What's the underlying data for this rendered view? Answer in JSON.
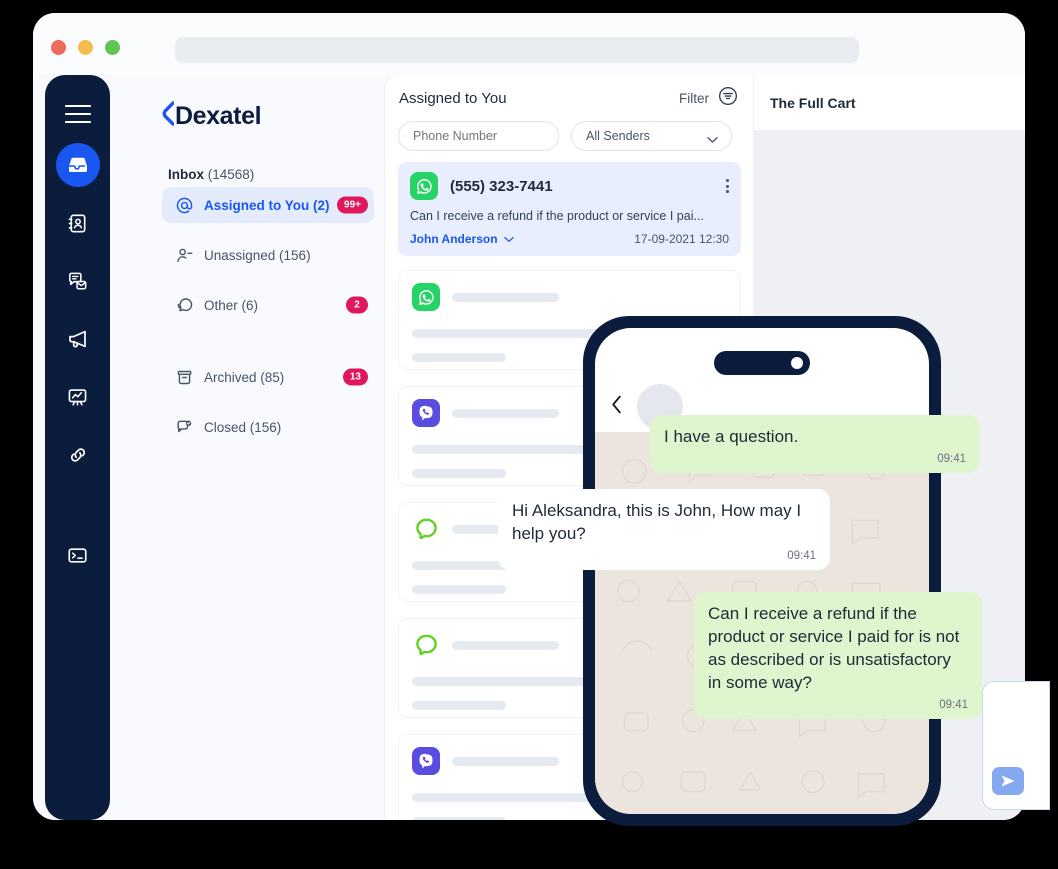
{
  "window": {
    "traffic_lights": [
      "close",
      "minimize",
      "maximize"
    ],
    "url_value": ""
  },
  "rail": {
    "menu_icon": "hamburger-menu-icon",
    "items": [
      {
        "icon": "inbox-icon",
        "name": "inbox",
        "active": true
      },
      {
        "icon": "contacts-book-icon",
        "name": "contacts",
        "active": false
      },
      {
        "icon": "templates-icon",
        "name": "templates",
        "active": false
      },
      {
        "icon": "campaign-megaphone-icon",
        "name": "campaigns",
        "active": false
      },
      {
        "icon": "analytics-board-icon",
        "name": "analytics",
        "active": false
      },
      {
        "icon": "link-icon",
        "name": "links",
        "active": false
      },
      {
        "icon": "terminal-icon",
        "name": "developers",
        "active": false
      }
    ]
  },
  "brand": {
    "name": "Dexatel"
  },
  "sidebar": {
    "section_label": "Inbox",
    "section_count": "(14568)",
    "items": [
      {
        "icon": "at-mention-icon",
        "label": "Assigned to You (2)",
        "badge": "99+",
        "active": true
      },
      {
        "icon": "user-minus-icon",
        "label": "Unassigned (156)",
        "badge": "",
        "active": false
      },
      {
        "icon": "chat-bubbles-icon",
        "label": "Other (6)",
        "badge": "2",
        "active": false
      },
      {
        "icon": "archive-box-icon",
        "label": "Archived (85)",
        "badge": "13",
        "active": false
      },
      {
        "icon": "chat-check-icon",
        "label": "Closed (156)",
        "badge": "",
        "active": false
      }
    ]
  },
  "conversations": {
    "title": "Assigned to You",
    "filter_label": "Filter",
    "filter_icon": "filter-sliders-icon",
    "phone_placeholder": "Phone Number",
    "phone_value": "",
    "senders_selected": "All Senders",
    "senders_chevron": "chevron-down-icon",
    "selected_card": {
      "channel": "whatsapp-icon",
      "phone": "(555) 323-7441",
      "preview": "Can I receive a refund if the product or service I pai...",
      "agent": "John Anderson",
      "agent_chevron": "chevron-down-icon",
      "timestamp": "17-09-2021 12:30",
      "menu_icon": "more-vertical-icon"
    },
    "placeholder_rows": [
      {
        "channel": "whatsapp-icon"
      },
      {
        "channel": "viber-icon"
      },
      {
        "channel": "sms-chat-icon"
      },
      {
        "channel": "sms-chat-icon"
      },
      {
        "channel": "viber-icon"
      }
    ]
  },
  "right_panel": {
    "title": "The Full Cart"
  },
  "phone": {
    "back_icon": "chevron-left-icon",
    "avatar": "contact-avatar",
    "messages": [
      {
        "id": "bub1",
        "direction": "out",
        "text": "I have a question.",
        "time": "09:41"
      },
      {
        "id": "bub2",
        "direction": "in",
        "text": "Hi Aleksandra, this is John, How may I help you?",
        "time": "09:41"
      },
      {
        "id": "bub3",
        "direction": "out",
        "text": "Can I receive a refund if the product or service I paid for is not as described or is unsatisfactory in some way?",
        "time": "09:41"
      }
    ],
    "send_icon": "send-arrow-icon"
  },
  "colors": {
    "brand_navy": "#0c1c3d",
    "accent_blue": "#1a56f0",
    "badge_pink": "#e0175c",
    "whatsapp_green": "#25d366",
    "viber_purple": "#5b4ce0",
    "bubble_out": "#dff5cd",
    "chat_bg": "#ece5dd"
  }
}
